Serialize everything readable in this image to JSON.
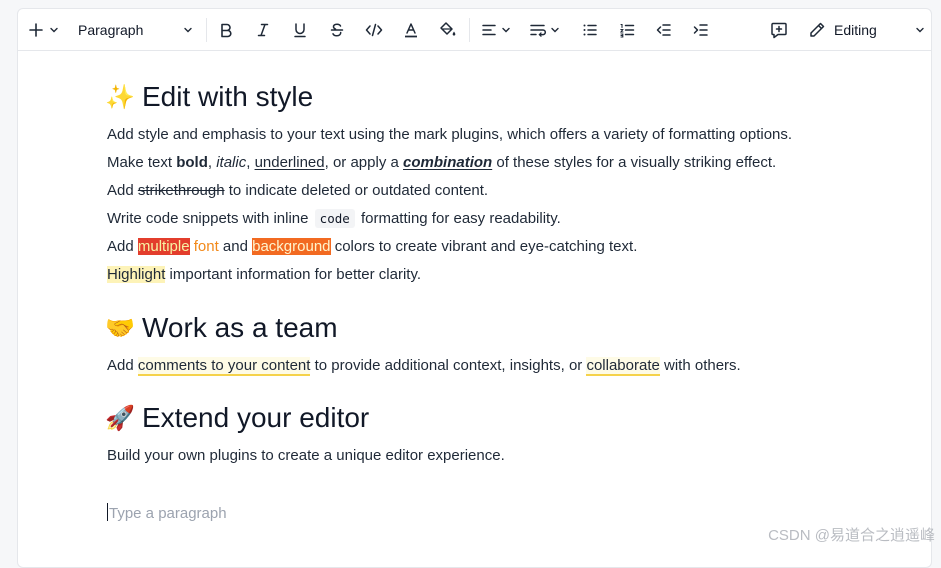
{
  "toolbar": {
    "insert_icon": "plus-icon",
    "block_type": "Paragraph",
    "buttons": [
      "bold-icon",
      "italic-icon",
      "underline-icon",
      "strikethrough-icon",
      "code-icon",
      "font-color-icon",
      "paint-bucket-icon",
      "align-icon",
      "line-height-icon",
      "bulleted-list-icon",
      "numbered-list-icon",
      "outdent-icon",
      "indent-icon",
      "comment-add-icon",
      "pencil-icon"
    ],
    "mode_label": "Editing"
  },
  "doc": {
    "h1": {
      "emoji": "✨",
      "text": "Edit with style"
    },
    "p1": "Add style and emphasis to your text using the mark plugins, which offers a variety of formatting options.",
    "p2": {
      "a": "Make text ",
      "bold": "bold",
      "b": ", ",
      "italic": "italic",
      "c": ", ",
      "underline": "underlined",
      "d": ", or apply a ",
      "combo": "combination",
      "e": " of these styles for a visually striking effect."
    },
    "p3": {
      "a": "Add ",
      "strike": "strikethrough",
      "b": " to indicate deleted or outdated content."
    },
    "p4": {
      "a": "Write code snippets with inline ",
      "code": "code",
      "b": " formatting for easy readability."
    },
    "p5": {
      "a": "Add ",
      "multiple": "multiple",
      "font": "font",
      "and": "and",
      "background": "background",
      "b": " colors to create vibrant and eye-catching text."
    },
    "p6": {
      "highlight": "Highlight",
      "b": " important information for better clarity."
    },
    "h2": {
      "emoji": "🤝",
      "text": "Work as a team"
    },
    "p7": {
      "a": "Add ",
      "comment1": "comments to your content",
      "b": " to provide additional context, insights, or ",
      "comment2": "collaborate",
      "c": " with others."
    },
    "h3": {
      "emoji": "🚀",
      "text": "Extend your editor"
    },
    "p8": "Build your own plugins to create a unique editor experience.",
    "placeholder": "Type a paragraph"
  },
  "watermark": "CSDN @易道合之逍遥峰",
  "colors": {
    "red_bg": "#e33d2c",
    "orange_text": "#f2891a",
    "orange_bg": "#f26a21",
    "highlight": "#fdf3b8",
    "comment_underline": "#f5d24b"
  }
}
